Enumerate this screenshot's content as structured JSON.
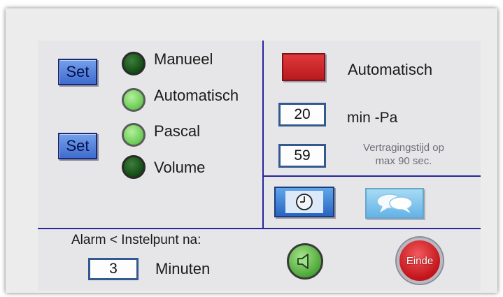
{
  "left_panel": {
    "set_button_top": "Set",
    "set_button_bottom": "Set",
    "options": [
      {
        "label": "Manueel",
        "state": "dark"
      },
      {
        "label": "Automatisch",
        "state": "light"
      },
      {
        "label": "Pascal",
        "state": "light"
      },
      {
        "label": "Volume",
        "state": "dark"
      }
    ]
  },
  "right_panel": {
    "mode_label": "Automatisch",
    "mode_indicator_color": "#d3282c",
    "pressure_value": "20",
    "pressure_unit": "min -Pa",
    "delay_value": "59",
    "delay_text_line1": "Vertragingstijd op",
    "delay_text_line2": "max 90 sec."
  },
  "bottom": {
    "alarm_label": "Alarm < Instelpunt na:",
    "minutes_value": "3",
    "minutes_label": "Minuten",
    "exit_label": "Einde"
  },
  "icons": {
    "clock": "clock-icon",
    "chat": "chat-bubbles-icon",
    "speaker": "speaker-icon"
  },
  "colors": {
    "divider": "#27269a",
    "set_button": "#4f7fe0",
    "led_on": "#62c84e",
    "led_off": "#0f4810",
    "exit_button": "#d41c22",
    "speaker_button": "#5dbf43"
  }
}
